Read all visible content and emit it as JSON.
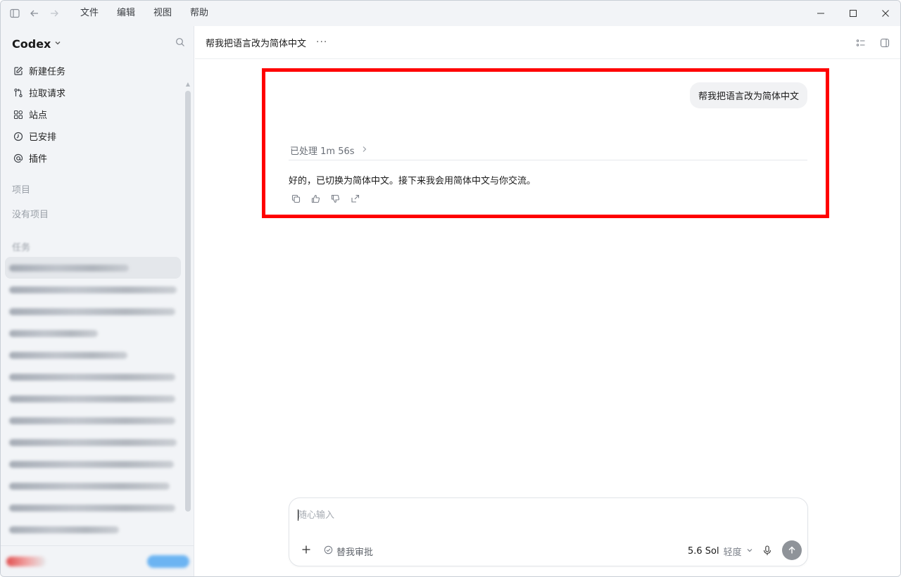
{
  "menu": [
    "文件",
    "编辑",
    "视图",
    "帮助"
  ],
  "sidebar": {
    "brand": "Codex",
    "nav": [
      {
        "label": "新建任务",
        "icon": "edit-icon"
      },
      {
        "label": "拉取请求",
        "icon": "pull-request-icon"
      },
      {
        "label": "站点",
        "icon": "grid-icon"
      },
      {
        "label": "已安排",
        "icon": "clock-icon"
      },
      {
        "label": "插件",
        "icon": "at-icon"
      }
    ],
    "projects_label": "项目",
    "no_projects": "没有项目",
    "tasks_label": "任务"
  },
  "main": {
    "title": "帮我把语言改为简体中文",
    "user_message": "帮我把语言改为简体中文",
    "processed_label": "已处理 1m 56s",
    "assistant_message": "好的，已切换为简体中文。接下来我会用简体中文与你交流。",
    "highlight_color": "#ff0000"
  },
  "composer": {
    "placeholder": "随心输入",
    "approval_label": "替我审批",
    "model": "5.6 Sol",
    "level": "轻度"
  },
  "colors": {
    "sidebar_bg": "#f2f4f7",
    "send_button": "#8f9399"
  }
}
